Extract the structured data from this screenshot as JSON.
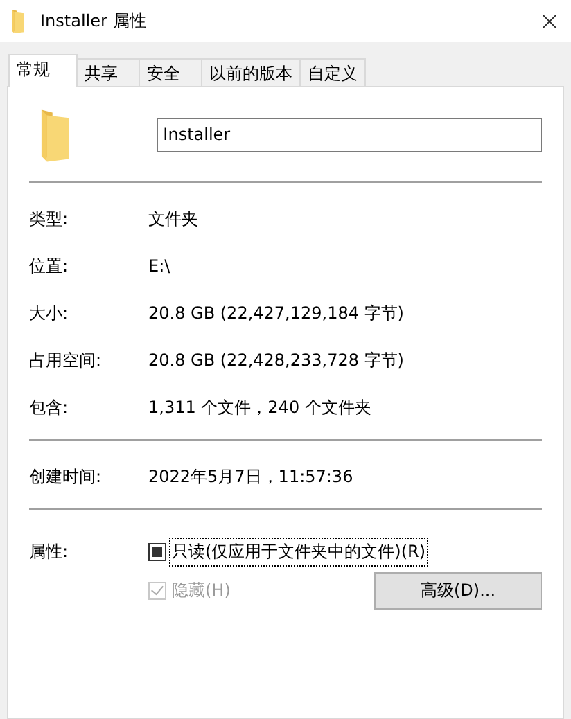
{
  "window": {
    "title": "Installer 属性"
  },
  "tabs": [
    {
      "label": "常规",
      "selected": true
    },
    {
      "label": "共享",
      "selected": false
    },
    {
      "label": "安全",
      "selected": false
    },
    {
      "label": "以前的版本",
      "selected": false
    },
    {
      "label": "自定义",
      "selected": false
    }
  ],
  "name_field": {
    "value": "Installer"
  },
  "groups": [
    [
      {
        "label": "类型:",
        "value": "文件夹"
      },
      {
        "label": "位置:",
        "value": "E:\\"
      },
      {
        "label": "大小:",
        "value": "20.8 GB (22,427,129,184 字节)"
      },
      {
        "label": "占用空间:",
        "value": "20.8 GB (22,428,233,728 字节)"
      },
      {
        "label": "包含:",
        "value": "1,311 个文件，240 个文件夹"
      }
    ],
    [
      {
        "label": "创建时间:",
        "value": "2022年5月7日，11:57:36"
      }
    ]
  ],
  "attributes": {
    "label": "属性:",
    "checkboxes": [
      {
        "label": "只读(仅应用于文件夹中的文件)(R)",
        "checked": false,
        "indeterminate": true,
        "disabled": false,
        "focused": true
      },
      {
        "label": "隐藏(H)",
        "checked": true,
        "indeterminate": false,
        "disabled": true,
        "focused": false
      }
    ],
    "button": "高级(D)..."
  }
}
